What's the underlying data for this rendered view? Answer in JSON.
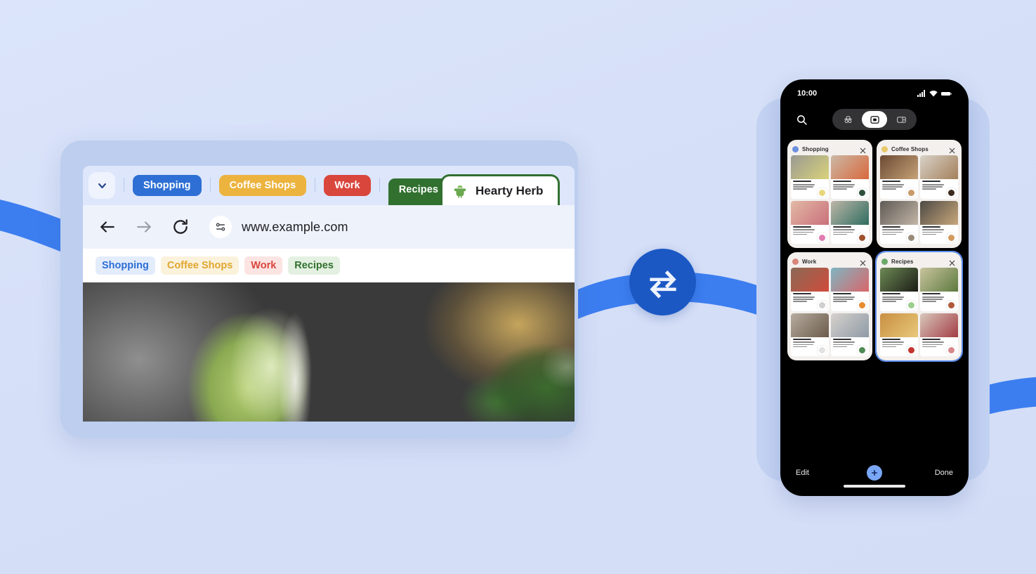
{
  "theme": {
    "background": "#d6e0f7",
    "ribbon_blue": "#3c7ef0",
    "tablet_frame": "#bdceef",
    "phone_glow": "#c3d2f2",
    "sync_circle": "#1b58c4",
    "selection_blue": "#5b8def"
  },
  "sync_badge": {
    "icon": "sync-arrows-icon",
    "label": "Sync"
  },
  "tablet": {
    "tabstrip": {
      "chevron_icon": "chevron-down-icon",
      "groups": [
        {
          "label": "Shopping",
          "color": "#2d6fd4",
          "text_color": "#ffffff"
        },
        {
          "label": "Coffee Shops",
          "color": "#ecb33e",
          "text_color": "#ffffff"
        },
        {
          "label": "Work",
          "color": "#d9463c",
          "text_color": "#ffffff"
        },
        {
          "label": "Recipes",
          "color": "#31702f",
          "text_color": "#ffffff"
        }
      ],
      "active_tab": {
        "title": "Hearty Herb",
        "favicon": "herb-salad-favicon",
        "group_color": "#31702f"
      }
    },
    "omnibox": {
      "back_icon": "back-arrow-icon",
      "forward_icon": "forward-arrow-icon",
      "reload_icon": "reload-icon",
      "site_settings_icon": "site-settings-icon",
      "url": "www.example.com"
    },
    "bookmarks": [
      {
        "label": "Shopping",
        "color": "#2d6fd4",
        "bg": "#e3ecfb"
      },
      {
        "label": "Coffee Shops",
        "color": "#e0a62f",
        "bg": "#fbf2dc"
      },
      {
        "label": "Work",
        "color": "#d9463c",
        "bg": "#fbe4e2"
      },
      {
        "label": "Recipes",
        "color": "#31702f",
        "bg": "#e4f1e2"
      }
    ],
    "page_image": {
      "alt": "food-photo-lime-bowl-herbs"
    }
  },
  "phone": {
    "status_bar": {
      "time": "10:00",
      "icons": [
        "signal-icon",
        "wifi-icon",
        "battery-icon"
      ]
    },
    "toolbar": {
      "search_icon": "search-icon",
      "segments": [
        {
          "icon": "incognito-icon",
          "selected": false
        },
        {
          "icon": "tabs-icon",
          "selected": true
        },
        {
          "icon": "tab-groups-icon",
          "selected": false
        }
      ]
    },
    "groups": [
      {
        "name": "Shopping",
        "dot_color": "#6b8ede",
        "selected": false,
        "close_icon": "close-icon",
        "tabs": [
          {
            "img_from": "#9a9a93",
            "img_to": "#d9d27a",
            "badge": "#e8d67a"
          },
          {
            "img_from": "#cbb9a6",
            "img_to": "#d9683c",
            "badge": "#2f4f3a"
          },
          {
            "img_from": "#e3b9a6",
            "img_to": "#c9707a",
            "badge": "#e27bb0"
          },
          {
            "img_from": "#bdb6a8",
            "img_to": "#2f6d60",
            "badge": "#a0522d"
          }
        ]
      },
      {
        "name": "Coffee Shops",
        "dot_color": "#e8c96a",
        "selected": false,
        "close_icon": "close-icon",
        "tabs": [
          {
            "img_from": "#6b4a33",
            "img_to": "#c6a277",
            "badge": "#c89a6a"
          },
          {
            "img_from": "#d8d2c8",
            "img_to": "#a4805b",
            "badge": "#3b2a1e"
          },
          {
            "img_from": "#5f5a55",
            "img_to": "#c2b5a6",
            "badge": "#9a8a7a"
          },
          {
            "img_from": "#4d4a44",
            "img_to": "#c8a77c",
            "badge": "#d39a5e"
          }
        ]
      },
      {
        "name": "Work",
        "dot_color": "#d9867a",
        "selected": false,
        "close_icon": "close-icon",
        "tabs": [
          {
            "img_from": "#8a6a55",
            "img_to": "#d14b3c",
            "badge": "#cfcfcf"
          },
          {
            "img_from": "#7fb6c2",
            "img_to": "#d8666a",
            "badge": "#e88b2f"
          },
          {
            "img_from": "#b7ada0",
            "img_to": "#6b5a4a",
            "badge": "#e2e2e2"
          },
          {
            "img_from": "#d6d2cd",
            "img_to": "#8e9aa6",
            "badge": "#4f8a55"
          }
        ]
      },
      {
        "name": "Recipes",
        "dot_color": "#6aa96a",
        "selected": true,
        "close_icon": "close-icon",
        "tabs": [
          {
            "img_from": "#6d8a55",
            "img_to": "#1c1c16",
            "badge": "#9ccf8e"
          },
          {
            "img_from": "#c9c49e",
            "img_to": "#5d7a3e",
            "badge": "#b0593a"
          },
          {
            "img_from": "#c98f42",
            "img_to": "#e8c87a",
            "badge": "#c4342e"
          },
          {
            "img_from": "#d8c8bc",
            "img_to": "#a33c44",
            "badge": "#d88a8a"
          }
        ]
      }
    ],
    "bottom_bar": {
      "edit_label": "Edit",
      "done_label": "Done",
      "add_icon": "plus-icon"
    }
  }
}
